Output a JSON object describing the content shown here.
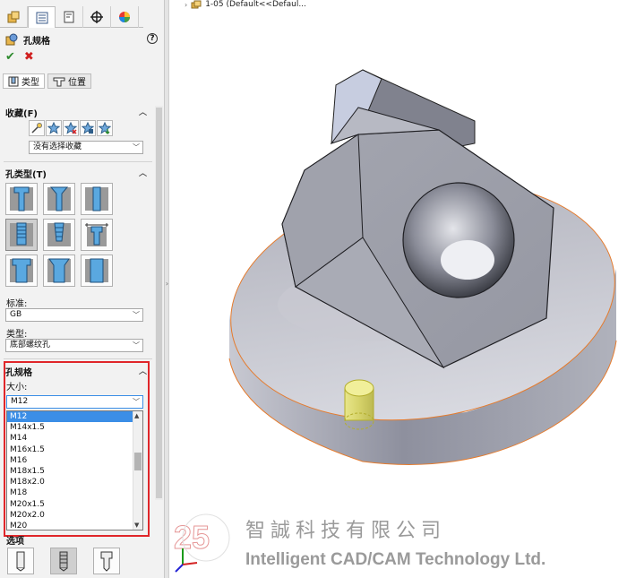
{
  "panel": {
    "title": "孔规格",
    "help": "?",
    "ok": "✔",
    "cancel": "✖",
    "tabs": {
      "type": "类型",
      "position": "位置"
    },
    "favorites": {
      "label": "收藏(F)",
      "select_value": "没有选择收藏"
    },
    "hole_type": {
      "label": "孔类型(T)",
      "standard_label": "标准:",
      "standard_value": "GB",
      "type_label": "类型:",
      "type_value": "底部螺纹孔"
    },
    "hole_spec": {
      "label": "孔规格",
      "size_label": "大小:",
      "size_value": "M12",
      "size_options": [
        "M12",
        "M14x1.5",
        "M14",
        "M16x1.5",
        "M16",
        "M18x1.5",
        "M18x2.0",
        "M18",
        "M20x1.5",
        "M20x2.0",
        "M20"
      ]
    },
    "options_label": "选项"
  },
  "viewport": {
    "tree_item": "1-05  (Default<<Defaul..."
  },
  "watermark": {
    "anniversary": "25",
    "chinese": "智誠科技有限公司",
    "english": "Intelligent CAD/CAM Technology Ltd."
  },
  "colors": {
    "accent_red": "#e0262a",
    "selection_blue": "#3b8ee6",
    "part_gray": "#a7a9b4"
  }
}
